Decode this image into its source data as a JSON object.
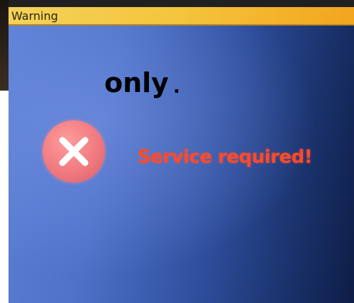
{
  "window": {
    "title": "Warning"
  },
  "overlay": {
    "text": "only",
    "dot": "."
  },
  "dialog": {
    "icon": "error-x-icon",
    "message": "Service required!"
  },
  "colors": {
    "titlebar": "#f4c43c",
    "background_light": "#5d80d6",
    "background_dark": "#0e1d46",
    "icon": "#f07a80",
    "message": "#ff4a2a"
  }
}
